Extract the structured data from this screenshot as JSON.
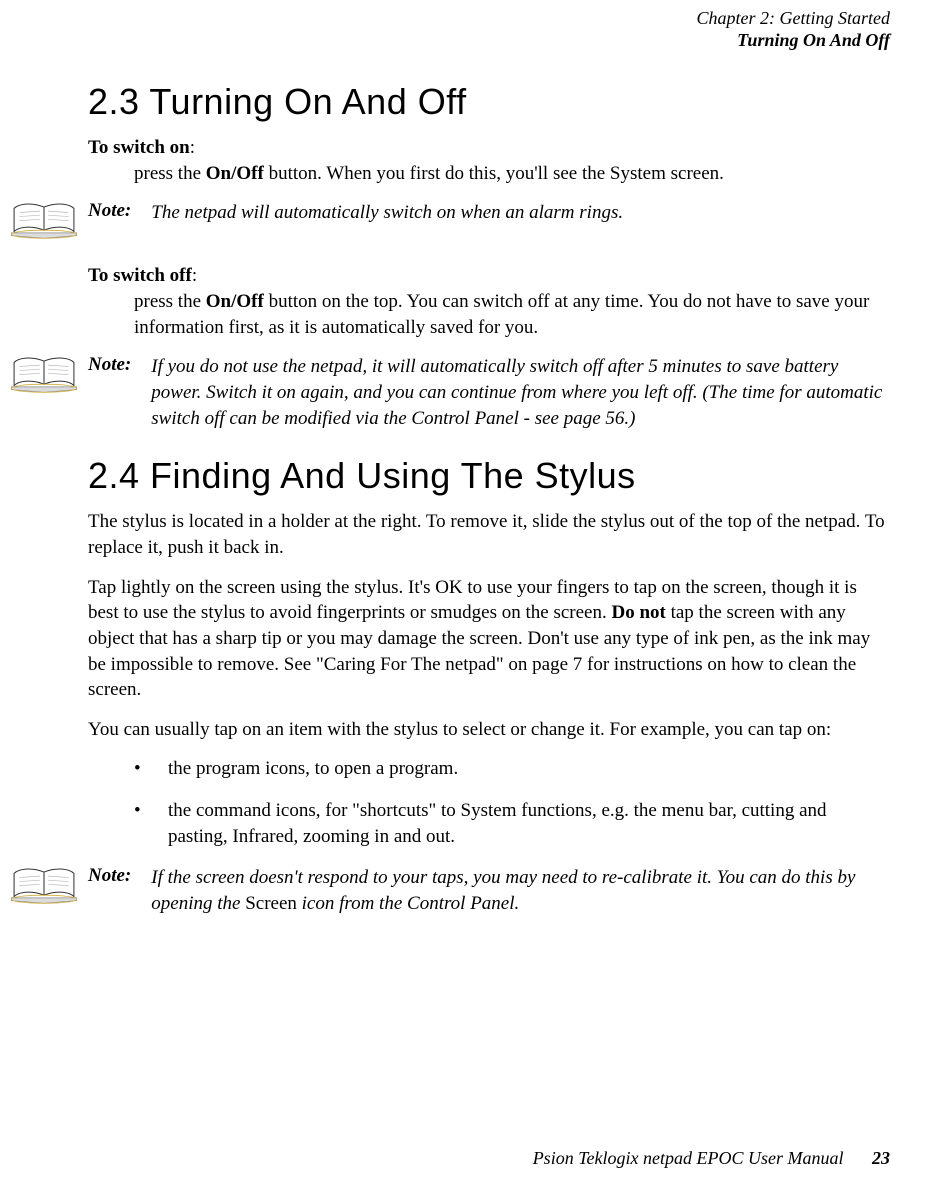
{
  "header": {
    "chapter": "Chapter 2:  Getting Started",
    "section": "Turning On And Off"
  },
  "s23": {
    "heading": "2.3  Turning On And Off",
    "switch_on_label": "To switch on",
    "switch_on_colon": ":",
    "switch_on_pre": "press the ",
    "switch_on_bold": "On/Off",
    "switch_on_post": " button. When you first do this, you'll see the System screen.",
    "note1_label": "Note:",
    "note1_text": "The netpad will automatically switch on when an alarm rings.",
    "switch_off_label": "To switch off",
    "switch_off_colon": ":",
    "switch_off_pre": "press the ",
    "switch_off_bold": "On/Off",
    "switch_off_post": " button on the top. You can switch off at any time. You do not have to save your information first, as it is automatically saved for you.",
    "note2_label": "Note:",
    "note2_text": "If you do not use the netpad, it will automatically switch off after 5 minutes to save battery power. Switch it on again, and you can continue from where you left off. (The time for automatic switch off can be modified via the Control Panel - see page 56.)"
  },
  "s24": {
    "heading": "2.4  Finding And Using The Stylus",
    "p1": "The stylus is located in a holder at the right. To remove it, slide the stylus out of the top of the netpad. To replace it, push it back in.",
    "p2a": "Tap lightly on the screen using the stylus. It's OK to use your fingers to tap on the screen, though it is best to use the stylus to avoid fingerprints or smudges on the screen. ",
    "p2b": "Do not",
    "p2c": " tap the screen with any object that has a sharp tip or you may damage the screen. Don't use any type of ink pen, as the ink may be impossible to remove. See \"Caring For The netpad\" on page 7 for instructions on how to clean the screen.",
    "p3": "You can usually tap on an item with the stylus to select or change it. For example, you can tap on:",
    "bullets": [
      "the program icons, to open a program.",
      "the command icons, for \"shortcuts\" to System functions, e.g. the menu bar, cutting and pasting, Infrared, zooming in and out."
    ],
    "note3_label": "Note:",
    "note3_a": "If the screen doesn't respond to your taps, you may need to re-calibrate it. You can do this by opening the ",
    "note3_b": "Screen",
    "note3_c": " icon from the Control Panel."
  },
  "footer": {
    "title": "Psion Teklogix netpad EPOC User Manual",
    "page": "23"
  }
}
